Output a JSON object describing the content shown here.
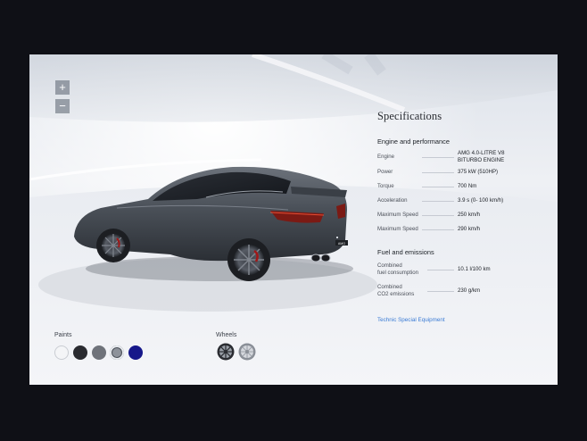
{
  "controls": {
    "zoom_in": "+",
    "zoom_out": "−"
  },
  "specs": {
    "title": "Specifications",
    "engine_section": {
      "title": "Engine and performance",
      "rows": [
        {
          "label": "Engine",
          "value_line1": "AMG 4.0-LITRE V8",
          "value_line2": "BITURBO ENGINE"
        },
        {
          "label": "Power",
          "value": "375 kW (510HP)"
        },
        {
          "label": "Torque",
          "value": "700 Nm"
        },
        {
          "label": "Acceleration",
          "value": "3.9 s (0- 100 km/h)"
        },
        {
          "label": "Maximum Speed",
          "value": "250 km/h"
        },
        {
          "label": "Maximum Speed",
          "value": "290 km/h"
        }
      ]
    },
    "fuel_section": {
      "title": "Fuel and emissions",
      "rows": [
        {
          "label_line1": "Combined",
          "label_line2": "fuel consumption",
          "value": "10.1 l/100 km"
        },
        {
          "label_line1": "Combined",
          "label_line2": "CO2 emissions",
          "value": "230 g/km"
        }
      ]
    },
    "link": "Technic Special Equipment"
  },
  "paints": {
    "label": "Paints",
    "swatches": [
      {
        "name": "white",
        "color": "#f4f5f7"
      },
      {
        "name": "black",
        "color": "#2a2b30"
      },
      {
        "name": "grey",
        "color": "#6f737a"
      },
      {
        "name": "selenite-grey",
        "color": "#8d929a",
        "selected": true
      },
      {
        "name": "blue",
        "color": "#16188a"
      }
    ]
  },
  "wheels": {
    "label": "Wheels",
    "items": [
      "wheel-dark",
      "wheel-silver"
    ]
  }
}
